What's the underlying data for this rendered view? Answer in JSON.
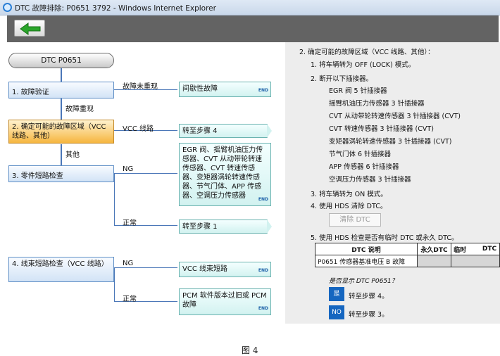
{
  "window": {
    "title": "DTC 故障排除: P0651 3792 - Windows Internet Explorer"
  },
  "toolbar": {
    "back_label": ""
  },
  "flow": {
    "start": "DTC P0651",
    "steps": [
      "1.  故障验证",
      "2.  确定可能的故障区域（VCC 线路、其他）",
      "3.  零件短路检查",
      "4.  线束短路检查（VCC 线路）"
    ],
    "branches": {
      "not_reproduced": "故障未重现",
      "reproduced": "故障重现",
      "vcc_line": "VCC 线路",
      "other": "其他",
      "ng_3": "NG",
      "ok_3": "正常",
      "ng_4": "NG",
      "ok_4": "正常"
    },
    "results": {
      "intermittent": "间歇性故障",
      "goto4": "转至步骤 4",
      "sensors": "EGR 阀、摇臂机油压力传感器、CVT 从动带轮转速传感器、CVT 转速传感器、变矩器涡轮转速传感器、节气门体、APP 传感器、空调压力传感器",
      "goto1": "转至步骤 1",
      "vcc_short": "VCC 线束短路",
      "pcm": "PCM 软件版本过旧或 PCM 故障"
    },
    "end_label": "END"
  },
  "right": {
    "heading": "2.  确定可能的故障区域（VCC 线路、其他）：",
    "items": [
      "1. 将车辆转为 OFF (LOCK) 模式。",
      "2. 断开以下插接器。",
      "3. 将车辆转为 ON 模式。",
      "4. 使用 HDS 清除 DTC。",
      "5. 使用 HDS 检查是否有临时 DTC 或永久 DTC。"
    ],
    "connectors": [
      "EGR 阀 5 针插接器",
      "摇臂机油压力传感器 3 针插接器",
      "CVT 从动带轮转速传感器 3 针插接器 (CVT)",
      "CVT 转速传感器 3 针插接器 (CVT)",
      "变矩器涡轮转速传感器 3 针插接器 (CVT)",
      "节气门体 6 针插接器",
      "APP 传感器 6 针插接器",
      "空调压力传感器 3 针插接器"
    ],
    "clear_button": "清除 DTC",
    "table": {
      "headers": [
        "DTC 说明",
        "永久DTC",
        "临时",
        "DTC"
      ],
      "row": "P0651 传感器基准电压 B 故障"
    },
    "question": "是否显示 DTC P0651？",
    "yes_btn": "是",
    "yes_text": "转至步骤 4。",
    "no_btn": "NO",
    "no_text": "转至步骤 3。"
  },
  "caption": "图 4"
}
